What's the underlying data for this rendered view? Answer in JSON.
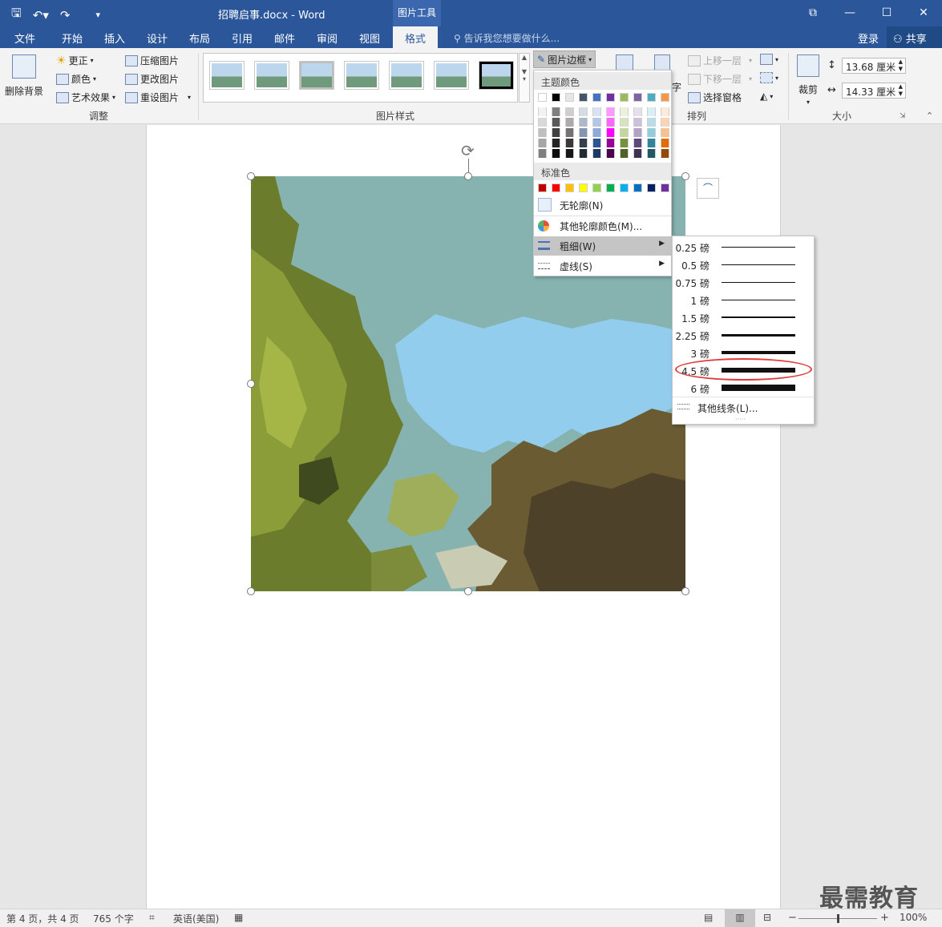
{
  "title_bar": {
    "doc_title": "招聘启事.docx - Word",
    "context_tab": "图片工具",
    "icons": [
      "save-icon",
      "undo-icon",
      "redo-icon",
      "customize-icon"
    ],
    "win_buttons": [
      "ribbon-display-icon",
      "minimize-icon",
      "maximize-icon",
      "close-icon"
    ]
  },
  "tabs": [
    "文件",
    "开始",
    "插入",
    "设计",
    "布局",
    "引用",
    "邮件",
    "审阅",
    "视图"
  ],
  "active_tab": "格式",
  "tell_me": "告诉我您想要做什么...",
  "login": "登录",
  "share": "共享",
  "ribbon": {
    "remove_bg": "删除背景",
    "corrections": "更正",
    "color": "颜色",
    "art_effects": "艺术效果",
    "compress": "压缩图片",
    "change_pic": "更改图片",
    "reset_pic": "重设图片",
    "group_adjust": "调整",
    "group_styles": "图片样式",
    "picture_border": "图片边框",
    "bring_forward": "上移一层",
    "send_backward": "下移一层",
    "selection_pane": "选择窗格",
    "wrap_text_partial": "字",
    "group_arrange": "排列",
    "crop": "裁剪",
    "height": "13.68 厘米",
    "width": "14.33 厘米",
    "group_size": "大小"
  },
  "border_menu": {
    "theme_colors_label": "主题颜色",
    "standard_colors_label": "标准色",
    "no_outline": "无轮廓(N)",
    "more_colors": "其他轮廓颜色(M)...",
    "weight": "粗细(W)",
    "dashes": "虚线(S)",
    "theme_top": [
      "#ffffff",
      "#000000",
      "#e7e6e6",
      "#44546a",
      "#4472c4",
      "#7030a0",
      "#9bbb59",
      "#8064a2",
      "#4bacc6",
      "#f79646"
    ],
    "theme_shades": [
      [
        "#f2f2f2",
        "#d9d9d9",
        "#bfbfbf",
        "#a6a6a6",
        "#7f7f7f"
      ],
      [
        "#7f7f7f",
        "#595959",
        "#404040",
        "#262626",
        "#0d0d0d"
      ],
      [
        "#d0cece",
        "#aeaaaa",
        "#757171",
        "#3a3838",
        "#171616"
      ],
      [
        "#d6dce4",
        "#adb9ca",
        "#8496b0",
        "#323f4f",
        "#222a35"
      ],
      [
        "#d9e2f3",
        "#b4c6e7",
        "#8eaadb",
        "#2f5496",
        "#1f3864"
      ],
      [
        "#ff99ff",
        "#ff66ff",
        "#ff00ff",
        "#990099",
        "#4d004d"
      ],
      [
        "#ebf1de",
        "#d7e4bd",
        "#c3d69b",
        "#76923c",
        "#4f6228"
      ],
      [
        "#e5e0ec",
        "#ccc1d9",
        "#b2a2c7",
        "#5f497a",
        "#3f3151"
      ],
      [
        "#dbeef3",
        "#b7dde8",
        "#92cddc",
        "#31859b",
        "#205867"
      ],
      [
        "#fdeada",
        "#fbd5b5",
        "#fac08f",
        "#e36c09",
        "#974806"
      ]
    ],
    "standard": [
      "#c00000",
      "#ff0000",
      "#ffc000",
      "#ffff00",
      "#92d050",
      "#00b050",
      "#00b0f0",
      "#0070c0",
      "#002060",
      "#7030a0"
    ]
  },
  "weights": [
    {
      "label": "0.25 磅",
      "pt": 0.25
    },
    {
      "label": "0.5 磅",
      "pt": 0.5
    },
    {
      "label": "0.75 磅",
      "pt": 0.75
    },
    {
      "label": "1 磅",
      "pt": 1
    },
    {
      "label": "1.5 磅",
      "pt": 1.5
    },
    {
      "label": "2.25 磅",
      "pt": 2.25
    },
    {
      "label": "3 磅",
      "pt": 3
    },
    {
      "label": "4.5 磅",
      "pt": 4.5
    },
    {
      "label": "6 磅",
      "pt": 6
    }
  ],
  "selected_weight": "4.5 磅",
  "more_lines": "其他线条(L)...",
  "status": {
    "page": "第 4 页，共 4 页",
    "words": "765 个字",
    "language": "英语(美国)",
    "zoom": "100%",
    "zoom_level": 1.0
  },
  "watermark": "最需教育"
}
